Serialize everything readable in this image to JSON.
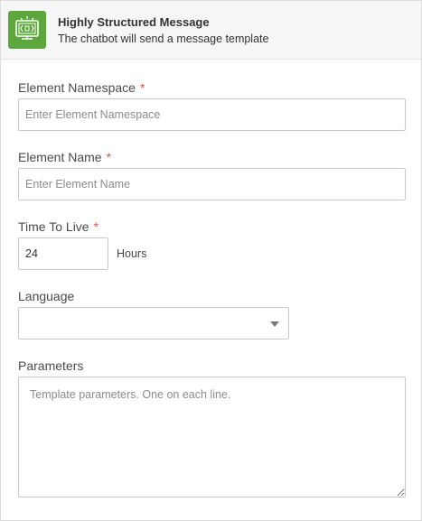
{
  "header": {
    "title": "Highly Structured Message",
    "subtitle": "The chatbot will send a message template",
    "icon": "message-template-icon",
    "icon_bg": "#5da83c"
  },
  "fields": {
    "namespace": {
      "label": "Element Namespace",
      "required_mark": "*",
      "placeholder": "Enter Element Namespace",
      "value": ""
    },
    "name": {
      "label": "Element Name",
      "required_mark": "*",
      "placeholder": "Enter Element Name",
      "value": ""
    },
    "ttl": {
      "label": "Time To Live",
      "required_mark": "*",
      "value": "24",
      "units": "Hours"
    },
    "language": {
      "label": "Language",
      "selected": ""
    },
    "parameters": {
      "label": "Parameters",
      "placeholder": "Template parameters. One on each line.",
      "value": ""
    }
  },
  "colors": {
    "required": "#e0524b",
    "header_bg": "#f6f6f6",
    "border": "#c9c9c9"
  }
}
